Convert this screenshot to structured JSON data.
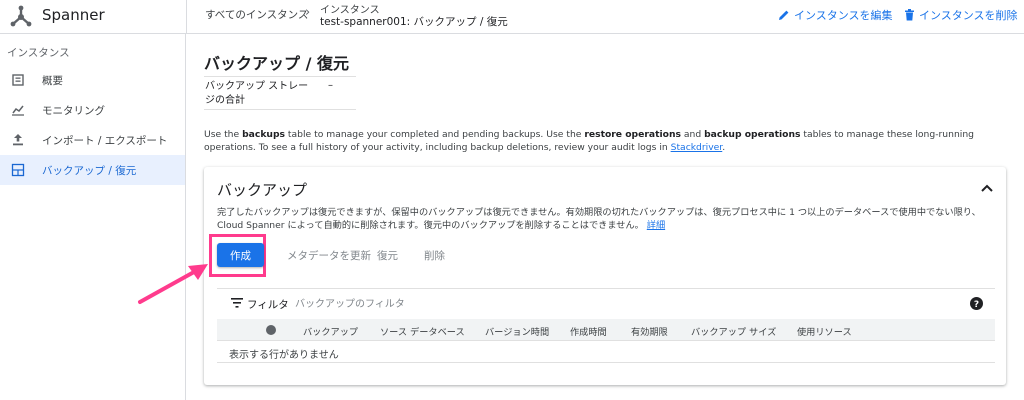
{
  "app": {
    "title": "Spanner"
  },
  "breadcrumb": {
    "root": "すべてのインスタンス",
    "section": "インスタンス",
    "current": "test-spanner001: バックアップ / 復元"
  },
  "top_actions": {
    "edit_label": "インスタンスを編集",
    "delete_label": "インスタンスを削除"
  },
  "sidebar": {
    "heading": "インスタンス",
    "items": [
      {
        "label": "概要",
        "icon": "overview-icon",
        "active": false
      },
      {
        "label": "モニタリング",
        "icon": "monitoring-icon",
        "active": false
      },
      {
        "label": "インポート / エクスポート",
        "icon": "import-export-icon",
        "active": false
      },
      {
        "label": "バックアップ / 復元",
        "icon": "backup-restore-icon",
        "active": true
      }
    ]
  },
  "main": {
    "title": "バックアップ / 復元",
    "storage": {
      "label": "バックアップ ストレージの合計",
      "value": "–"
    },
    "description": {
      "p1": "Use the ",
      "b1": "backups",
      "p2": " table to manage your completed and pending backups. Use the ",
      "b2": "restore operations",
      "p3": " and ",
      "b3": "backup operations",
      "p4": " tables to manage these long-running operations. To see a full history of your activity, including backup deletions, review your audit logs in ",
      "link": "Stackdriver",
      "p5": "."
    }
  },
  "backups_card": {
    "title": "バックアップ",
    "description": "完了したバックアップは復元できますが、保留中のバックアップは復元できません。有効期限の切れたバックアップは、復元プロセス中に 1 つ以上のデータベースで使用中でない限り、Cloud Spanner によって自動的に削除されます。復元中のバックアップを削除することはできません。",
    "details_link": "詳細",
    "buttons": {
      "create": "作成",
      "update_metadata": "メタデータを更新",
      "restore": "復元",
      "delete": "削除"
    },
    "filter": {
      "label": "フィルタ",
      "placeholder": "バックアップのフィルタ"
    },
    "columns": [
      "バックアップ",
      "ソース データベース",
      "バージョン時間",
      "作成時間",
      "有効期限",
      "バックアップ サイズ",
      "使用リソース"
    ],
    "empty_message": "表示する行がありません"
  },
  "colors": {
    "accent": "#1a73e8",
    "highlight": "#ff3b8d",
    "active_nav_bg": "#e8f0fe"
  }
}
